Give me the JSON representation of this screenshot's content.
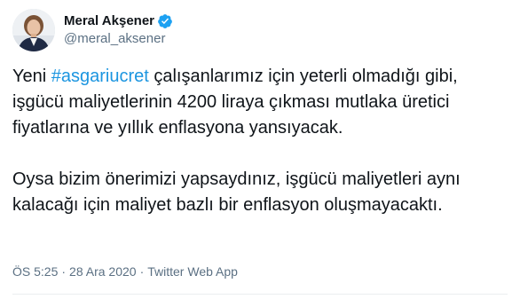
{
  "user": {
    "display_name": "Meral Akşener",
    "handle": "@meral_aksener",
    "verified_icon": "verified-badge-icon",
    "avatar_icon": "profile-avatar"
  },
  "tweet": {
    "paragraph1": {
      "prefix": "Yeni ",
      "hashtag": "#asgariucret",
      "rest": " çalışanlarımız için yeterli olmadığı gibi, işgücü maliyetlerinin 4200 liraya çıkması mutlaka üretici fiyatlarına ve yıllık enflasyona yansıyacak."
    },
    "paragraph2": "Oysa bizim önerimizi yapsaydınız, işgücü maliyetleri aynı kalacağı için maliyet bazlı bir enflasyon oluşmayacaktı."
  },
  "meta": {
    "time": "ÖS 5:25",
    "separator": "·",
    "date": "28 Ara 2020",
    "source": "Twitter Web App"
  },
  "colors": {
    "hashtag": "#1b95e0",
    "verified": "#1da1f2",
    "secondary_text": "#5b7083",
    "primary_text": "#0f1419"
  }
}
